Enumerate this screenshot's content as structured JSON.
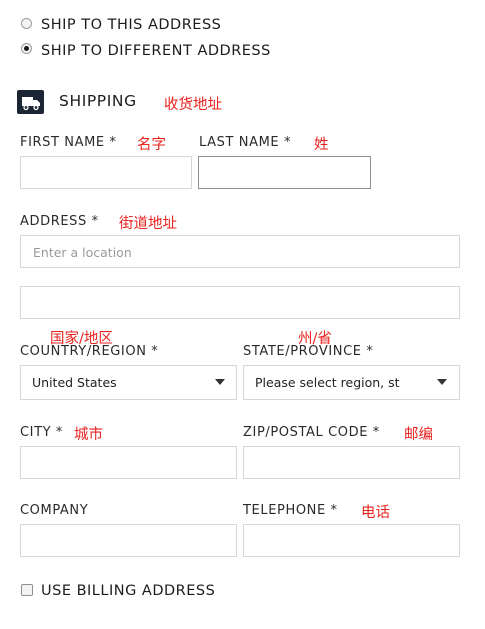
{
  "shipping_options": {
    "ship_to_this": {
      "label": "SHIP TO THIS ADDRESS",
      "checked": false
    },
    "ship_to_different": {
      "label": "SHIP TO DIFFERENT ADDRESS",
      "checked": true
    }
  },
  "section": {
    "icon": "truck-icon",
    "title": "SHIPPING",
    "note": "收货地址"
  },
  "fields": {
    "first_name": {
      "label": "FIRST NAME *",
      "note": "名字",
      "value": ""
    },
    "last_name": {
      "label": "LAST NAME *",
      "note": "姓",
      "value": ""
    },
    "address": {
      "label": "ADDRESS *",
      "note": "街道地址",
      "placeholder": "Enter a location",
      "value": ""
    },
    "address2": {
      "value": ""
    },
    "country": {
      "label": "COUNTRY/REGION *",
      "note": "国家/地区",
      "value": "United States"
    },
    "state": {
      "label": "STATE/PROVINCE *",
      "note": "州/省",
      "value": "Please select region, st"
    },
    "city": {
      "label": "CITY *",
      "note": "城市",
      "value": ""
    },
    "zip": {
      "label": "ZIP/POSTAL CODE *",
      "note": "邮编",
      "value": ""
    },
    "company": {
      "label": "COMPANY",
      "value": ""
    },
    "telephone": {
      "label": "TELEPHONE *",
      "note": "电话",
      "value": ""
    }
  },
  "billing": {
    "label": "USE BILLING ADDRESS",
    "checked": false
  },
  "colors": {
    "note": "#e8231f",
    "icon_bg": "#1c2533"
  }
}
